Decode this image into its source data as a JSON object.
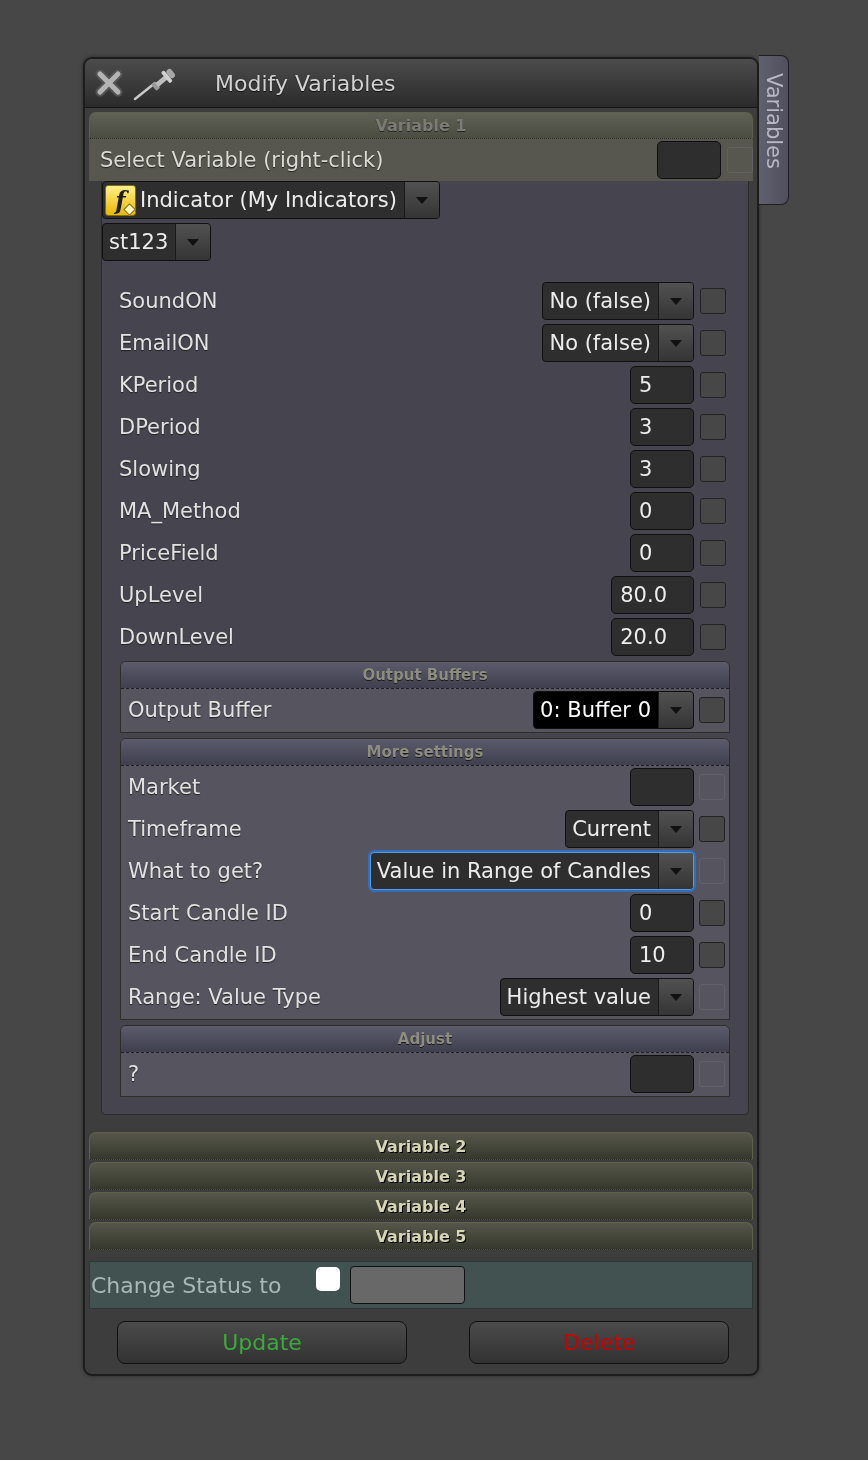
{
  "window": {
    "title": "Modify Variables"
  },
  "side_tab": {
    "label": "Variables"
  },
  "variables": [
    {
      "title": "Variable 1",
      "expanded": true,
      "select_row": {
        "label": "Select Variable (right-click)",
        "checked": false,
        "checkbox_disabled": true
      },
      "source": {
        "icon_text": "f",
        "value": "Indicator (My Indicators)"
      },
      "indicator": {
        "value": "st123"
      },
      "parameters": [
        {
          "label": "SoundON",
          "kind": "dropdown",
          "value": "No (false)",
          "checked": false,
          "checkbox_disabled": false
        },
        {
          "label": "EmailON",
          "kind": "dropdown",
          "value": "No (false)",
          "checked": false,
          "checkbox_disabled": false
        },
        {
          "label": "KPeriod",
          "kind": "input",
          "value": "5",
          "checked": false,
          "checkbox_disabled": false
        },
        {
          "label": "DPeriod",
          "kind": "input",
          "value": "3",
          "checked": false,
          "checkbox_disabled": false
        },
        {
          "label": "Slowing",
          "kind": "input",
          "value": "3",
          "checked": false,
          "checkbox_disabled": false
        },
        {
          "label": "MA_Method",
          "kind": "input",
          "value": "0",
          "checked": false,
          "checkbox_disabled": false
        },
        {
          "label": "PriceField",
          "kind": "input",
          "value": "0",
          "checked": false,
          "checkbox_disabled": false
        },
        {
          "label": "UpLevel",
          "kind": "input",
          "value": "80.0",
          "checked": false,
          "checkbox_disabled": false
        },
        {
          "label": "DownLevel",
          "kind": "input",
          "value": "20.0",
          "checked": false,
          "checkbox_disabled": false
        }
      ],
      "sections": [
        {
          "title": "Output Buffers",
          "rows": [
            {
              "label": "Output Buffer",
              "kind": "dropdown",
              "value": "0: Buffer 0",
              "highlighted": true,
              "focused": false,
              "checked": false,
              "checkbox_disabled": false
            }
          ]
        },
        {
          "title": "More settings",
          "rows": [
            {
              "label": "Market",
              "kind": "input",
              "highlighted": false,
              "focused": false,
              "checked": false,
              "checkbox_disabled": true
            },
            {
              "label": "Timeframe",
              "kind": "dropdown",
              "value": "Current",
              "highlighted": false,
              "focused": false,
              "checked": false,
              "checkbox_disabled": false
            },
            {
              "label": "What to get?",
              "kind": "dropdown",
              "value": "Value in Range of Candles",
              "highlighted": false,
              "focused": true,
              "checked": false,
              "checkbox_disabled": true
            },
            {
              "label": "Start Candle ID",
              "kind": "input",
              "value": "0",
              "highlighted": false,
              "focused": false,
              "checked": false,
              "checkbox_disabled": false
            },
            {
              "label": "End Candle ID",
              "kind": "input",
              "value": "10",
              "highlighted": false,
              "focused": false,
              "checked": false,
              "checkbox_disabled": false
            },
            {
              "label": "Range: Value Type",
              "kind": "dropdown",
              "value": "Highest value",
              "highlighted": false,
              "focused": false,
              "checked": false,
              "checkbox_disabled": true
            }
          ]
        },
        {
          "title": "Adjust",
          "rows": [
            {
              "label": "?",
              "kind": "input",
              "highlighted": false,
              "focused": false,
              "checked": false,
              "checkbox_disabled": true
            }
          ]
        }
      ]
    },
    {
      "title": "Variable 2",
      "expanded": false
    },
    {
      "title": "Variable 3",
      "expanded": false
    },
    {
      "title": "Variable 4",
      "expanded": false
    },
    {
      "title": "Variable 5",
      "expanded": false
    }
  ],
  "status": {
    "label": "Change Status to",
    "checked": false
  },
  "buttons": [
    {
      "label": "Update",
      "kind": "update"
    },
    {
      "label": "Delete",
      "kind": "delete"
    }
  ]
}
